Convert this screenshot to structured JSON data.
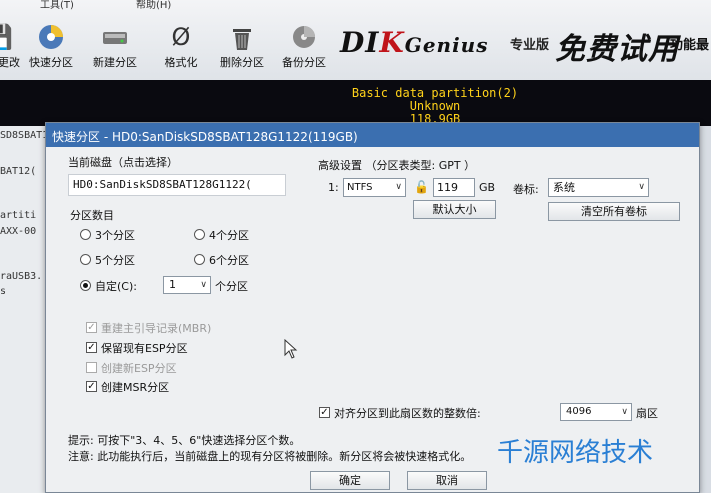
{
  "menu": {
    "items": [
      "工具(T)",
      "帮助(H)"
    ]
  },
  "toolbar": {
    "buttons": [
      {
        "label": "保存更改"
      },
      {
        "label": "快速分区"
      },
      {
        "label": "新建分区"
      },
      {
        "label": "格式化"
      },
      {
        "label": "删除分区"
      },
      {
        "label": "备份分区"
      }
    ]
  },
  "brand": {
    "logo_a": "DI",
    "logo_b": "K",
    "logo_c": "Genius",
    "edition": "专业版",
    "trial": "免费试用",
    "func": "功能最"
  },
  "disk_map": {
    "line1": "Basic data partition(2)",
    "line2": "Unknown",
    "line3": "118.9GB"
  },
  "left_panel": [
    "SD8SBAT1",
    "BAT12(",
    "artiti",
    "AXX-00",
    "raUSB3.",
    "s"
  ],
  "dialog": {
    "title": "快速分区 - HD0:SanDiskSD8SBAT128G1122(119GB)",
    "current_disk_label": "当前磁盘（点击选择）",
    "current_disk_value": "HD0:SanDiskSD8SBAT128G1122(",
    "partition_count_label": "分区数目",
    "options": [
      "3个分区",
      "4个分区",
      "5个分区",
      "6个分区"
    ],
    "custom_label": "自定(C):",
    "custom_value": "1",
    "custom_suffix": "个分区",
    "advanced_label": "高级设置 （分区表类型: GPT ）",
    "row_index": "1:",
    "fs_value": "NTFS",
    "size_value": "119",
    "size_unit": "GB",
    "volume_label_label": "卷标:",
    "volume_label_value": "系统",
    "default_size_button": "默认大小",
    "clear_labels_button": "清空所有卷标",
    "rebuild_mbr": "重建主引导记录(MBR)",
    "keep_esp": "保留现有ESP分区",
    "create_esp": "创建新ESP分区",
    "create_msr": "创建MSR分区",
    "align_label": "对齐分区到此扇区数的整数倍:",
    "align_value": "4096",
    "align_unit": "扇区",
    "hint_1": "提示: 可按下\"3、4、5、6\"快速选择分区个数。",
    "hint_2": "注意: 此功能执行后，当前磁盘上的现有分区将被删除。新分区将会被快速格式化。",
    "ok_button": "确定",
    "cancel_button": "取消"
  },
  "watermark": "千源网络技术"
}
